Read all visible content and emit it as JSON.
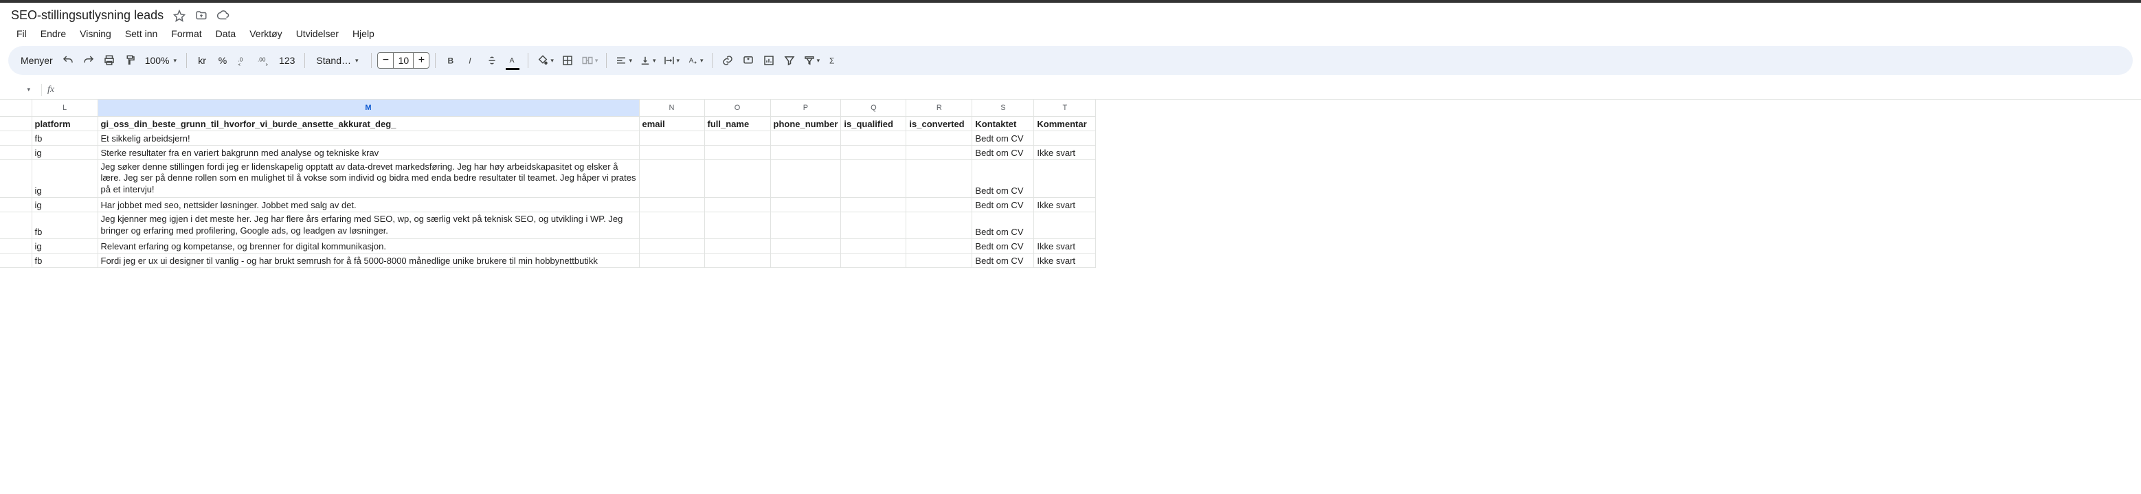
{
  "doc": {
    "title": "SEO-stillingsutlysning leads"
  },
  "menu": {
    "menys": "Menyer",
    "fil": "Fil",
    "endre": "Endre",
    "visning": "Visning",
    "settinn": "Sett inn",
    "format": "Format",
    "data": "Data",
    "verktoy": "Verktøy",
    "utvidelser": "Utvidelser",
    "hjelp": "Hjelp"
  },
  "toolbar": {
    "zoom": "100%",
    "currency": "kr",
    "percent": "%",
    "num": "123",
    "font": "Stand…",
    "size": "10"
  },
  "namebox": {
    "cell": "",
    "fx": ""
  },
  "cols": [
    "L",
    "M",
    "N",
    "O",
    "P",
    "Q",
    "R",
    "S",
    "T"
  ],
  "selected_col": "M",
  "headers": {
    "L": "platform",
    "M": "gi_oss_din_beste_grunn_til_hvorfor_vi_burde_ansette_akkurat_deg_",
    "N": "email",
    "O": "full_name",
    "P": "phone_number",
    "Q": "is_qualified",
    "R": "is_converted",
    "S": "Kontaktet",
    "T": "Kommentar"
  },
  "rows": [
    {
      "L": "fb",
      "M": "Et sikkelig arbeidsjern!",
      "S": "Bedt om CV",
      "T": "",
      "wrap": false
    },
    {
      "L": "ig",
      "M": "Sterke resultater fra en variert bakgrunn med analyse og tekniske krav",
      "S": "Bedt om CV",
      "T": "Ikke svart",
      "wrap": false
    },
    {
      "L": "ig",
      "M": "Jeg søker denne stillingen fordi jeg er lidenskapelig opptatt av data-drevet markedsføring. Jeg har høy arbeidskapasitet og elsker å lære. Jeg ser på denne rollen som en mulighet til å vokse som individ og bidra med enda bedre resultater til teamet. Jeg håper vi prates på et intervju!",
      "S": "Bedt om CV",
      "T": "",
      "wrap": true
    },
    {
      "L": "ig",
      "M": "Har jobbet med seo, nettsider løsninger. Jobbet med salg av det.",
      "S": "Bedt om CV",
      "T": "Ikke svart",
      "wrap": false
    },
    {
      "L": "fb",
      "M": "Jeg kjenner meg igjen i det meste her. Jeg har flere års erfaring med SEO, wp, og særlig vekt på teknisk SEO, og utvikling i WP. Jeg bringer og erfaring med profilering, Google ads, og leadgen av løsninger.",
      "S": "Bedt om CV",
      "T": "",
      "wrap": true
    },
    {
      "L": "ig",
      "M": "Relevant erfaring og kompetanse, og brenner for digital kommunikasjon.",
      "S": "Bedt om CV",
      "T": "Ikke svart",
      "wrap": false
    },
    {
      "L": "fb",
      "M": "Fordi jeg er ux ui designer til vanlig - og har brukt semrush for å få 5000-8000 månedlige unike brukere til min hobbynettbutikk",
      "S": "Bedt om CV",
      "T": "Ikke svart",
      "wrap": false
    }
  ]
}
